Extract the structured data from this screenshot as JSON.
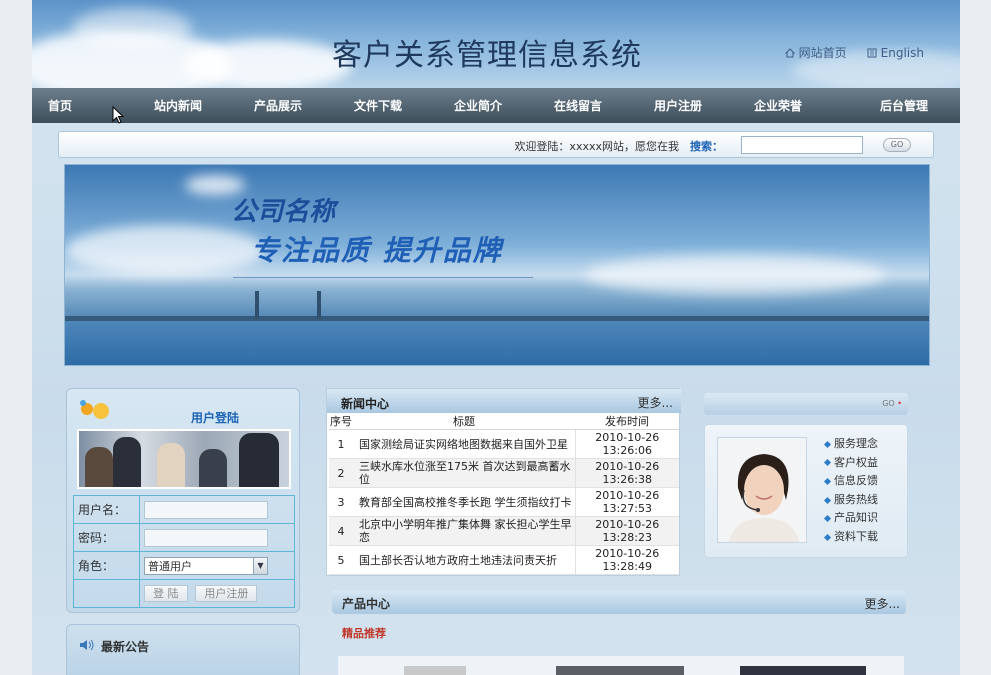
{
  "header": {
    "site_title": "客户关系管理信息系统",
    "home_link": "网站首页",
    "english_link": "English"
  },
  "nav": {
    "items": [
      "首页",
      "站内新闻",
      "产品展示",
      "文件下载",
      "企业简介",
      "在线留言",
      "用户注册",
      "企业荣誉",
      "后台管理"
    ]
  },
  "searchbar": {
    "welcome": "欢迎登陆：xxxxx网站，愿您在我",
    "search_label": "搜索：",
    "search_value": "",
    "go_label": "GO"
  },
  "banner": {
    "company": "公司名称",
    "slogan": "专注品质 提升品牌"
  },
  "login": {
    "title": "用户登陆",
    "username_label": "用户名：",
    "password_label": "密码：",
    "role_label": "角色：",
    "role_value": "普通用户",
    "login_button": "登 陆",
    "register_button": "用户注册"
  },
  "notice": {
    "title": "最新公告"
  },
  "news": {
    "title": "新闻中心",
    "more": "更多...",
    "columns": [
      "序号",
      "标题",
      "发布时间"
    ],
    "rows": [
      {
        "num": "1",
        "title": "国家测绘局证实网络地图数据来自国外卫星",
        "date": "2010-10-26",
        "time": "13:26:06"
      },
      {
        "num": "2",
        "title": "三峡水库水位涨至175米 首次达到最高蓄水位",
        "date": "2010-10-26",
        "time": "13:26:38"
      },
      {
        "num": "3",
        "title": "教育部全国高校推冬季长跑 学生须指纹打卡",
        "date": "2010-10-26",
        "time": "13:27:53"
      },
      {
        "num": "4",
        "title": "北京中小学明年推广集体舞 家长担心学生早恋",
        "date": "2010-10-26",
        "time": "13:28:23"
      },
      {
        "num": "5",
        "title": "国土部长否认地方政府土地违法问责天折",
        "date": "2010-10-26",
        "time": "13:28:49"
      }
    ]
  },
  "products": {
    "title": "产品中心",
    "more": "更多...",
    "featured": "精品推荐"
  },
  "right": {
    "go_label": "GO",
    "service_items": [
      "服务理念",
      "客户权益",
      "信息反馈",
      "服务热线",
      "产品知识",
      "资料下载"
    ]
  },
  "colors": {
    "nav_bg": "#4a5a67",
    "accent_blue": "#1d63b6",
    "featured_red": "#c0392b"
  }
}
